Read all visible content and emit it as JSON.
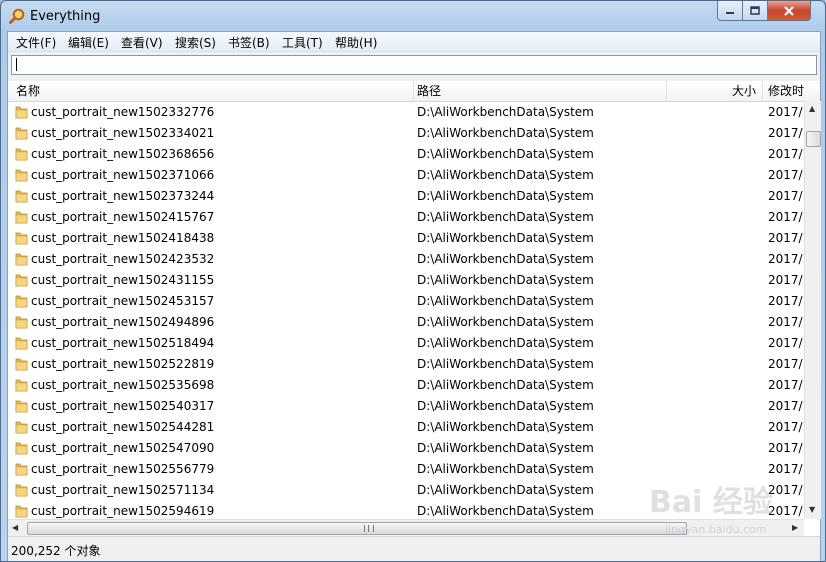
{
  "window": {
    "title": "Everything"
  },
  "menu": [
    {
      "label": "文件(F)"
    },
    {
      "label": "编辑(E)"
    },
    {
      "label": "查看(V)"
    },
    {
      "label": "搜索(S)"
    },
    {
      "label": "书签(B)"
    },
    {
      "label": "工具(T)"
    },
    {
      "label": "帮助(H)"
    }
  ],
  "search": {
    "value": "",
    "placeholder": ""
  },
  "columns": {
    "name": "名称",
    "path": "路径",
    "size": "大小",
    "date": "修改时"
  },
  "rows": [
    {
      "name": "cust_portrait_new1502332776",
      "path": "D:\\AliWorkbenchData\\System",
      "date": "2017/..."
    },
    {
      "name": "cust_portrait_new1502334021",
      "path": "D:\\AliWorkbenchData\\System",
      "date": "2017/..."
    },
    {
      "name": "cust_portrait_new1502368656",
      "path": "D:\\AliWorkbenchData\\System",
      "date": "2017/..."
    },
    {
      "name": "cust_portrait_new1502371066",
      "path": "D:\\AliWorkbenchData\\System",
      "date": "2017/..."
    },
    {
      "name": "cust_portrait_new1502373244",
      "path": "D:\\AliWorkbenchData\\System",
      "date": "2017/..."
    },
    {
      "name": "cust_portrait_new1502415767",
      "path": "D:\\AliWorkbenchData\\System",
      "date": "2017/..."
    },
    {
      "name": "cust_portrait_new1502418438",
      "path": "D:\\AliWorkbenchData\\System",
      "date": "2017/..."
    },
    {
      "name": "cust_portrait_new1502423532",
      "path": "D:\\AliWorkbenchData\\System",
      "date": "2017/..."
    },
    {
      "name": "cust_portrait_new1502431155",
      "path": "D:\\AliWorkbenchData\\System",
      "date": "2017/..."
    },
    {
      "name": "cust_portrait_new1502453157",
      "path": "D:\\AliWorkbenchData\\System",
      "date": "2017/..."
    },
    {
      "name": "cust_portrait_new1502494896",
      "path": "D:\\AliWorkbenchData\\System",
      "date": "2017/..."
    },
    {
      "name": "cust_portrait_new1502518494",
      "path": "D:\\AliWorkbenchData\\System",
      "date": "2017/..."
    },
    {
      "name": "cust_portrait_new1502522819",
      "path": "D:\\AliWorkbenchData\\System",
      "date": "2017/..."
    },
    {
      "name": "cust_portrait_new1502535698",
      "path": "D:\\AliWorkbenchData\\System",
      "date": "2017/..."
    },
    {
      "name": "cust_portrait_new1502540317",
      "path": "D:\\AliWorkbenchData\\System",
      "date": "2017/..."
    },
    {
      "name": "cust_portrait_new1502544281",
      "path": "D:\\AliWorkbenchData\\System",
      "date": "2017/..."
    },
    {
      "name": "cust_portrait_new1502547090",
      "path": "D:\\AliWorkbenchData\\System",
      "date": "2017/..."
    },
    {
      "name": "cust_portrait_new1502556779",
      "path": "D:\\AliWorkbenchData\\System",
      "date": "2017/..."
    },
    {
      "name": "cust_portrait_new1502571134",
      "path": "D:\\AliWorkbenchData\\System",
      "date": "2017/..."
    },
    {
      "name": "cust_portrait_new1502594619",
      "path": "D:\\AliWorkbenchData\\System",
      "date": "2017/..."
    }
  ],
  "status": {
    "count_text": "200,252 个对象"
  },
  "watermark": {
    "text": "Bai 经验",
    "sub": "jingyan.baidu.com"
  },
  "icons": {
    "app": "magnifier-icon",
    "row": "folder-icon"
  },
  "colors": {
    "folder": "#e8b84a",
    "titlebar": "#aecbea",
    "close": "#c7472b"
  }
}
